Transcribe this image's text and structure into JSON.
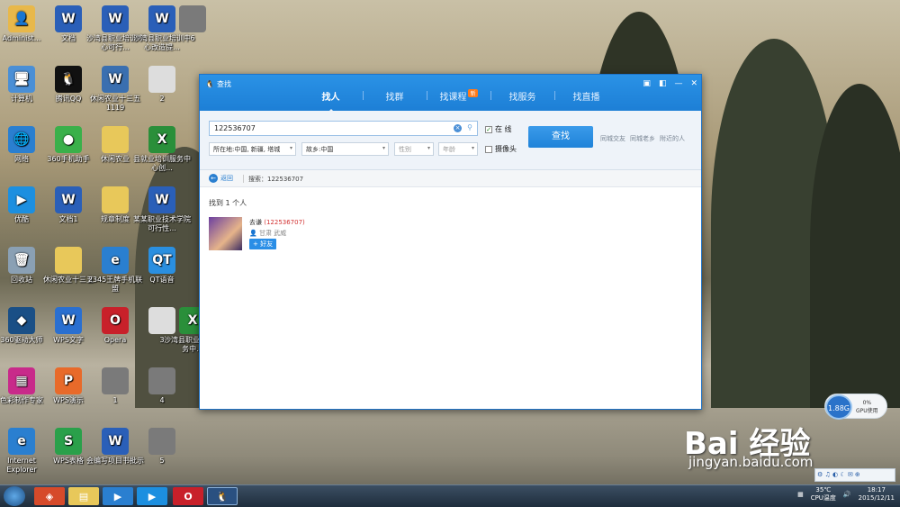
{
  "desktop_icons": [
    {
      "label": "Administ...",
      "color": "#e8b84a",
      "glyph": "👤"
    },
    {
      "label": "文档",
      "color": "#2a5fb8",
      "glyph": "W"
    },
    {
      "label": "沙湾县职业培训中心可行...",
      "color": "#2a5fb8",
      "glyph": "W"
    },
    {
      "label": "沙湾县职业培训中心改造提...",
      "color": "#2a5fb8",
      "glyph": "W"
    },
    {
      "label": "6",
      "color": "#7a7a7a",
      "glyph": ""
    },
    {
      "label": "计算机",
      "color": "#4a8fd6",
      "glyph": "🖥"
    },
    {
      "label": "腾讯QQ",
      "color": "#111",
      "glyph": "🐧"
    },
    {
      "label": "休闲农业十三五1119",
      "color": "#3a6fb0",
      "glyph": "W"
    },
    {
      "label": "2",
      "color": "#ddd",
      "glyph": ""
    },
    {
      "label": "网络",
      "color": "#2a7fd0",
      "glyph": "🌐"
    },
    {
      "label": "360手机助手",
      "color": "#3ab04a",
      "glyph": "●"
    },
    {
      "label": "休闲农业",
      "color": "#e8c85a",
      "glyph": ""
    },
    {
      "label": "县就业培训服务中心创...",
      "color": "#2a8f3a",
      "glyph": "X"
    },
    {
      "label": "优酷",
      "color": "#1c8fe0",
      "glyph": "▶"
    },
    {
      "label": "文档1",
      "color": "#2a5fb8",
      "glyph": "W"
    },
    {
      "label": "规章制度",
      "color": "#e8c85a",
      "glyph": ""
    },
    {
      "label": "某某职业技术学院可行性...",
      "color": "#2a5fb8",
      "glyph": "W"
    },
    {
      "label": "回收站",
      "color": "#8aa0b4",
      "glyph": "🗑"
    },
    {
      "label": "休闲农业十三五",
      "color": "#e8c85a",
      "glyph": ""
    },
    {
      "label": "2345王牌手机联盟",
      "color": "#2a7fd0",
      "glyph": "e"
    },
    {
      "label": "QT语音",
      "color": "#2a8fe0",
      "glyph": "QT"
    },
    {
      "label": "360驱动大师",
      "color": "#1a4f86",
      "glyph": "◆"
    },
    {
      "label": "WPS文字",
      "color": "#2a6fd0",
      "glyph": "W"
    },
    {
      "label": "Opera",
      "color": "#c8202a",
      "glyph": "O"
    },
    {
      "label": "3",
      "color": "#ddd",
      "glyph": ""
    },
    {
      "label": "沙湾县职业培训服务中...",
      "color": "#2a8f3a",
      "glyph": "X"
    },
    {
      "label": "色彩制作专家",
      "color": "#c82a8a",
      "glyph": "▦"
    },
    {
      "label": "WPS演示",
      "color": "#e86a2a",
      "glyph": "P"
    },
    {
      "label": "1",
      "color": "#7a7a7a",
      "glyph": ""
    },
    {
      "label": "4",
      "color": "#7a7a7a",
      "glyph": ""
    },
    {
      "label": "Internet Explorer",
      "color": "#2a7fd0",
      "glyph": "e"
    },
    {
      "label": "WPS表格",
      "color": "#2aa04a",
      "glyph": "S"
    },
    {
      "label": "会编写项目书批示",
      "color": "#2a5fb8",
      "glyph": "W"
    },
    {
      "label": "5",
      "color": "#7a7a7a",
      "glyph": ""
    }
  ],
  "window": {
    "title": "查找",
    "tabs": [
      {
        "label": "找人",
        "active": true
      },
      {
        "label": "找群"
      },
      {
        "label": "找课程",
        "badge": "新"
      },
      {
        "label": "找服务"
      },
      {
        "label": "找直播"
      }
    ],
    "search": {
      "value": "122536707",
      "online_label": "在 线",
      "online_checked": true,
      "camera_label": "摄像头",
      "camera_checked": false,
      "button": "查找"
    },
    "filters": {
      "location": "所在地:中国, 新疆, 塔城",
      "hometown": "故乡:中国",
      "gender": "性别",
      "age": "年龄"
    },
    "quick_links": [
      "同城交友",
      "同城老乡",
      "附近的人"
    ],
    "nav": {
      "back": "返回",
      "crumb": "搜索：122536707"
    },
    "results_count": "找到 1 个人",
    "result": {
      "name": "去谦",
      "id": "(122536707)",
      "location": "甘肃 武威",
      "add_button": "+ 好友"
    }
  },
  "gpu": {
    "value": "1.88G",
    "percent": "0%",
    "label": "GPU使用"
  },
  "watermark": {
    "brand": "Bai 经验",
    "url": "jingyan.baidu.com"
  },
  "taskbar": {
    "temp": "35℃",
    "temp_label": "CPU温度",
    "time": "18:17",
    "date": "2015/12/11"
  }
}
